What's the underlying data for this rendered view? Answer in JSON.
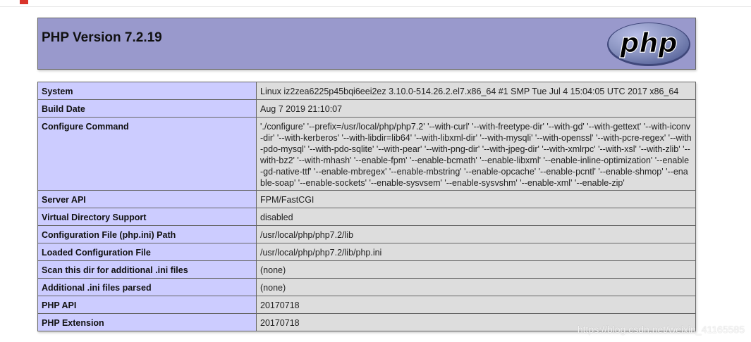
{
  "page": {
    "title": "PHP Version 7.2.19",
    "logo_text": "php"
  },
  "colors": {
    "header_bg": "#9999cc",
    "label_bg": "#ccccff",
    "value_bg": "#dddddd",
    "border": "#666666"
  },
  "rows": [
    {
      "label": "System",
      "value": "Linux iz2zea6225p45bqi6eei2ez 3.10.0-514.26.2.el7.x86_64 #1 SMP Tue Jul 4 15:04:05 UTC 2017 x86_64"
    },
    {
      "label": "Build Date",
      "value": "Aug 7 2019 21:10:07"
    },
    {
      "label": "Configure Command",
      "value": "'./configure' '--prefix=/usr/local/php/php7.2' '--with-curl' '--with-freetype-dir' '--with-gd' '--with-gettext' '--with-iconv-dir' '--with-kerberos' '--with-libdir=lib64' '--with-libxml-dir' '--with-mysqli' '--with-openssl' '--with-pcre-regex' '--with-pdo-mysql' '--with-pdo-sqlite' '--with-pear' '--with-png-dir' '--with-jpeg-dir' '--with-xmlrpc' '--with-xsl' '--with-zlib' '--with-bz2' '--with-mhash' '--enable-fpm' '--enable-bcmath' '--enable-libxml' '--enable-inline-optimization' '--enable-gd-native-ttf' '--enable-mbregex' '--enable-mbstring' '--enable-opcache' '--enable-pcntl' '--enable-shmop' '--enable-soap' '--enable-sockets' '--enable-sysvsem' '--enable-sysvshm' '--enable-xml' '--enable-zip'"
    },
    {
      "label": "Server API",
      "value": "FPM/FastCGI"
    },
    {
      "label": "Virtual Directory Support",
      "value": "disabled"
    },
    {
      "label": "Configuration File (php.ini) Path",
      "value": "/usr/local/php/php7.2/lib"
    },
    {
      "label": "Loaded Configuration File",
      "value": "/usr/local/php/php7.2/lib/php.ini"
    },
    {
      "label": "Scan this dir for additional .ini files",
      "value": "(none)"
    },
    {
      "label": "Additional .ini files parsed",
      "value": "(none)"
    },
    {
      "label": "PHP API",
      "value": "20170718"
    },
    {
      "label": "PHP Extension",
      "value": "20170718"
    }
  ],
  "watermark": "https://blog.csdn.net/weixin_41165585"
}
